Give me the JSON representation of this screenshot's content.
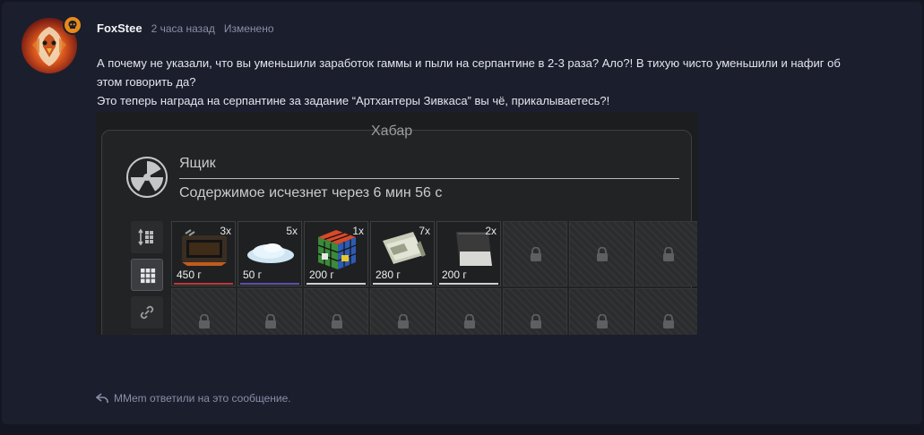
{
  "post": {
    "username": "FoxStee",
    "time": "2 часа назад",
    "edited": "Изменено",
    "line1": "А почему не указали, что вы уменьшили заработок гаммы и пыли на серпантине в 2-3 раза? Ало?! В тихую чисто уменьшили и нафиг об",
    "line2": "этом говорить да?",
    "line3": "Это теперь награда на серпантине за задание “Артхантеры Зивкаса” вы чё, прикалываетесь?!",
    "badge_icon": "skull-icon",
    "avatar_icon": "eagle-avatar"
  },
  "screenshot": {
    "top_name": "Хабар",
    "box_title": "Ящик",
    "box_subtitle": "Содержимое исчезнет через 6 мин 56 с",
    "items": [
      {
        "qty": "3x",
        "price": "450 г",
        "icon": "device-icon",
        "bar": "#c0353a"
      },
      {
        "qty": "5x",
        "price": "50 г",
        "icon": "dust-icon",
        "bar": "#5a4fb0"
      },
      {
        "qty": "1x",
        "price": "200 г",
        "icon": "cube-icon",
        "bar": "#cfd0d2"
      },
      {
        "qty": "7x",
        "price": "280 г",
        "icon": "money-icon",
        "bar": "#cfd0d2"
      },
      {
        "qty": "2x",
        "price": "200 г",
        "icon": "notebook-icon",
        "bar": "#cfd0d2"
      }
    ]
  },
  "reply": {
    "text": "MMem ответили на это сообщение."
  }
}
